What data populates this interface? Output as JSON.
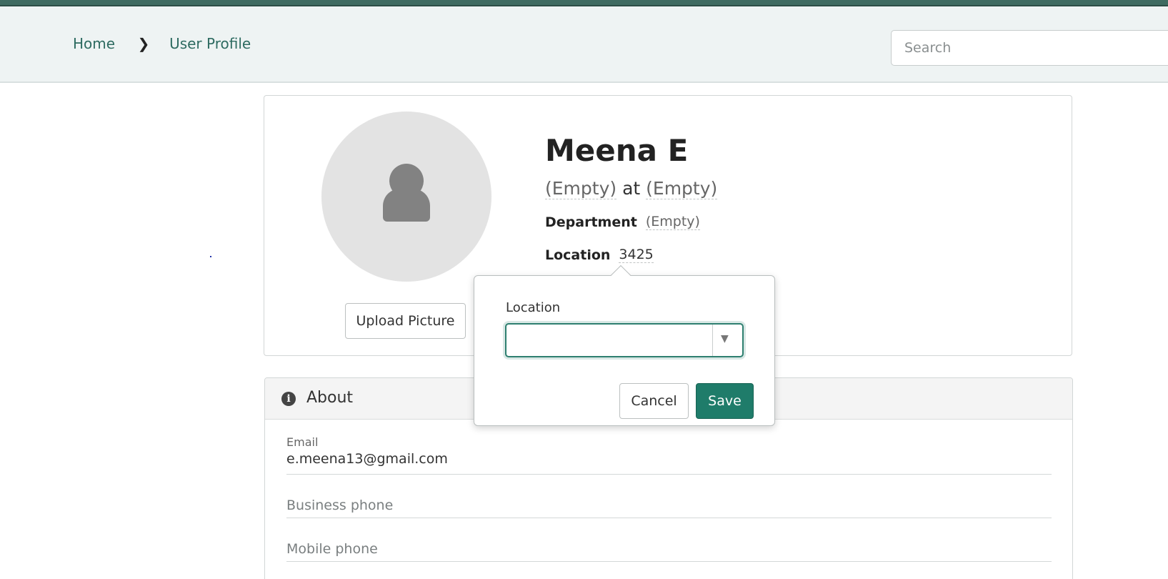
{
  "breadcrumb": {
    "home": "Home",
    "separator": "❯",
    "current": "User Profile"
  },
  "search": {
    "placeholder": "Search",
    "value": ""
  },
  "profile": {
    "name": "Meena E",
    "title_empty": "(Empty)",
    "at": "at",
    "company_empty": "(Empty)",
    "department_label": "Department",
    "department_value": "(Empty)",
    "location_label": "Location",
    "location_value": "3425",
    "upload_label": "Upload Picture"
  },
  "popover": {
    "label": "Location",
    "select_value": "",
    "caret": "▼",
    "cancel_label": "Cancel",
    "save_label": "Save"
  },
  "about": {
    "icon": "info-icon",
    "icon_glyph": "i",
    "title": "About",
    "email_label": "Email",
    "email_value": "e.meena13@gmail.com",
    "business_phone_placeholder": "Business phone",
    "mobile_phone_placeholder": "Mobile phone"
  },
  "colors": {
    "accent": "#1f7c6a",
    "topbar": "#3f6b61",
    "link": "#2e6b61"
  }
}
